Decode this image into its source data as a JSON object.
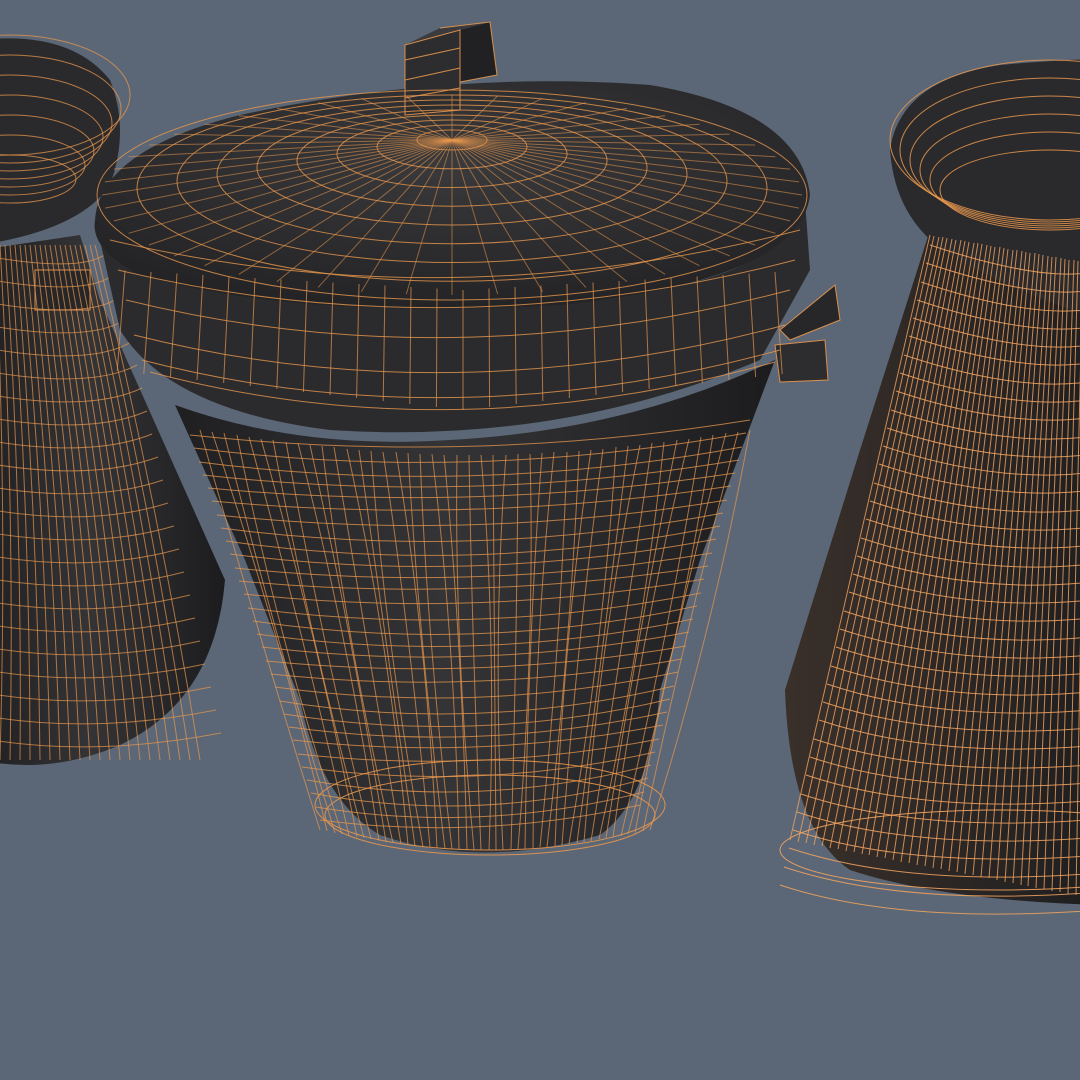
{
  "viewport": {
    "background": "#5b6776",
    "render_mode": "shaded-wireframe",
    "shade_color": "#2f2f31",
    "wire_color": "#e8974e",
    "wire_color_highlight": "#f4a460"
  },
  "objects": [
    {
      "name": "trash-can-left",
      "partially_visible": true,
      "lid": "closed",
      "body": "dented-ribbed"
    },
    {
      "name": "trash-can-center",
      "partially_visible": false,
      "lid": "closed-with-handle",
      "body": "crumpled-ribbed",
      "side_handles": 2
    },
    {
      "name": "trash-can-right",
      "partially_visible": true,
      "lid": "rim-only",
      "body": "ribbed",
      "wire_density": "high"
    }
  ]
}
